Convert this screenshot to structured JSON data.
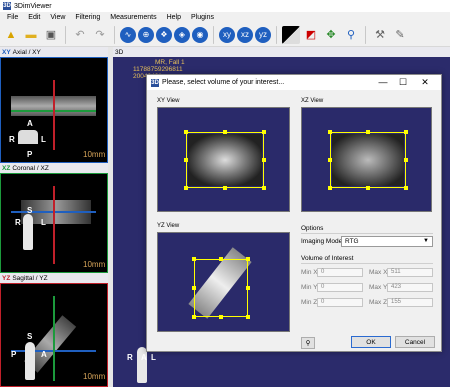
{
  "app": {
    "title": "3DimViewer",
    "icon_letter": "3D"
  },
  "menu": [
    "File",
    "Edit",
    "View",
    "Filtering",
    "Measurements",
    "Help",
    "Plugins"
  ],
  "toolbar_icons": [
    "open-icon",
    "save-icon",
    "undo-icon",
    "redo-icon",
    "density-window-icon",
    "measure-icon",
    "segment-icon",
    "volume-icon",
    "zoom-icon"
  ],
  "panels": {
    "axial": {
      "axis": "XY",
      "title": "Axial / XY",
      "axis_color": "#1f5fbf"
    },
    "coronal": {
      "axis": "XZ",
      "title": "Coronal / XZ",
      "axis_color": "#1c9a3c"
    },
    "sagittal": {
      "axis": "YZ",
      "title": "Sagittal / YZ",
      "axis_color": "#c0202a"
    },
    "view3d": {
      "title": "3D"
    }
  },
  "scale_label": "10mm",
  "orientation": {
    "A": "A",
    "P": "P",
    "R": "R",
    "L": "L",
    "S": "S"
  },
  "view3d_info": [
    "MR, Fall 1",
    "11788759296811",
    "20040421"
  ],
  "dialog": {
    "title": "Please, select volume of your interest...",
    "xy_label": "XY View",
    "xz_label": "XZ View",
    "yz_label": "YZ View",
    "options_label": "Options",
    "imaging_mode_label": "Imaging Mode",
    "imaging_mode_value": "RTG",
    "voi_label": "Volume of Interest",
    "min_x_label": "Min X",
    "min_x": "0",
    "max_x_label": "Max X",
    "max_x": "511",
    "min_y_label": "Min Y",
    "min_y": "0",
    "max_y_label": "Max Y",
    "max_y": "423",
    "min_z_label": "Min Z",
    "min_z": "0",
    "max_z_label": "Max Z",
    "max_z": "155",
    "ok_label": "OK",
    "cancel_label": "Cancel"
  }
}
